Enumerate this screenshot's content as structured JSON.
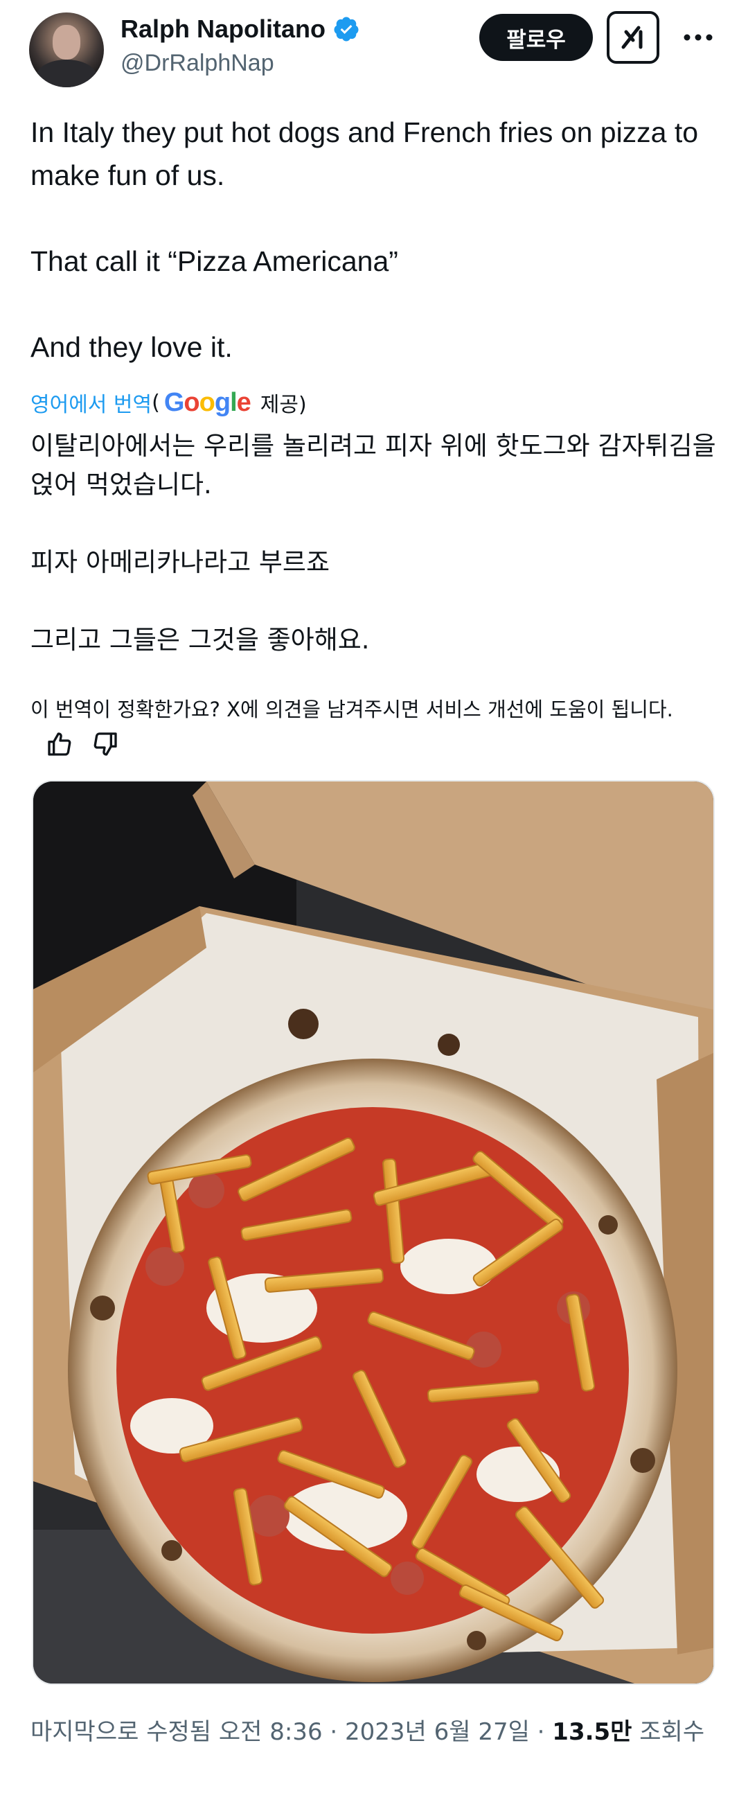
{
  "author": {
    "display_name": "Ralph Napolitano",
    "handle": "@DrRalphNap",
    "verified": true
  },
  "actions": {
    "follow_label": "팔로우",
    "grok_icon": "grok-icon",
    "more_icon": "more-icon"
  },
  "tweet": {
    "text": "In Italy they put hot dogs and French fries on pizza to make fun of us.\n\nThat call it “Pizza Americana”\n\nAnd they love it."
  },
  "translation": {
    "link_label": "영어에서 번역",
    "paren_open": "(",
    "provider_logo": "Google",
    "provided_label": "제공)",
    "text": "이탈리아에서는 우리를 놀리려고 피자 위에 핫도그와 감자튀김을 얹어 먹었습니다.\n\n피자 아메리카나라고 부르죠\n\n그리고 그들은 그것을 좋아해요.",
    "feedback_prompt": "이 번역이 정확한가요? X에 의견을 남겨주시면 서비스 개선에 도움이 됩니다."
  },
  "media": {
    "description_icon": "pizza-photo"
  },
  "meta": {
    "edited_label": "마지막으로 수정됨 오전 8:36 · 2023년 6월 27일 · ",
    "views_count": "13.5만",
    "views_label": " 조회수"
  },
  "colors": {
    "accent": "#1d9bf0",
    "text": "#0f1419",
    "muted": "#536471",
    "button_bg": "#0f1419"
  }
}
